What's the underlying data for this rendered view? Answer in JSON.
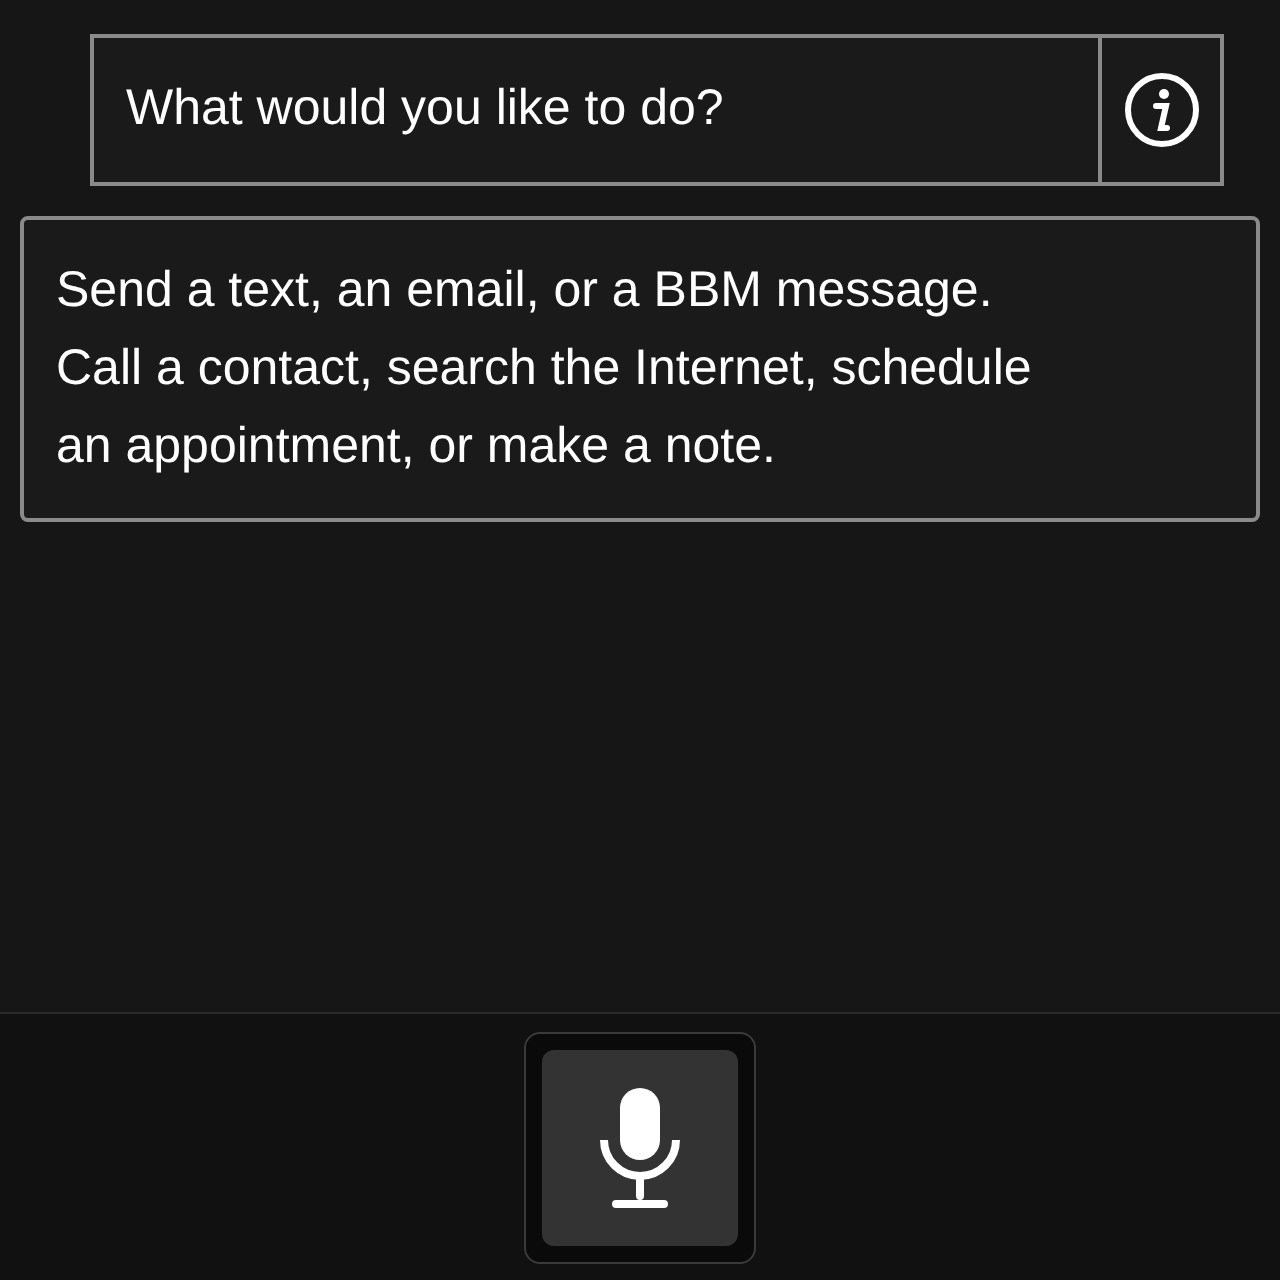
{
  "prompt": {
    "text": "What would you like to do?"
  },
  "hint": {
    "lines": [
      "Send a text, an email, or a BBM message.",
      "Call a contact, search the Internet, schedule",
      "an appointment, or make a note."
    ]
  }
}
